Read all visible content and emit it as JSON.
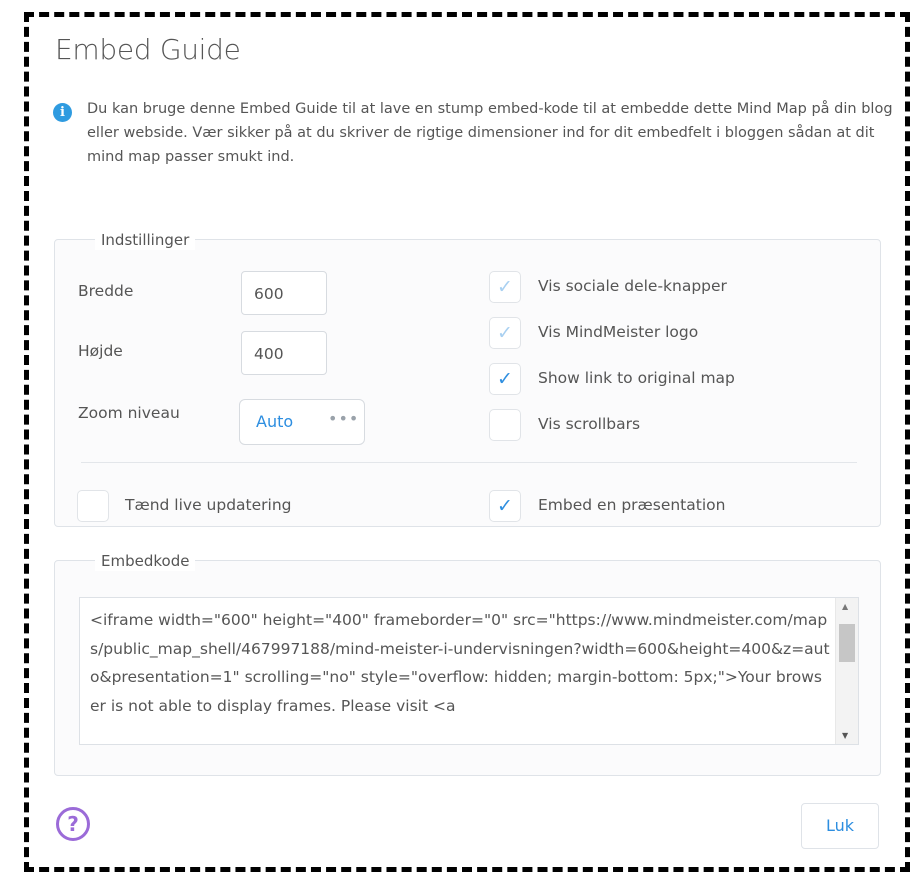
{
  "dialog": {
    "title": "Embed Guide",
    "info_text": "Du kan bruge denne Embed Guide til at lave en stump embed-kode til at embedde dette Mind Map på din blog eller webside. Vær sikker på at du skriver de rigtige dimensioner ind for dit embedfelt i bloggen sådan at dit mind map passer smukt ind.",
    "close_label": "Luk"
  },
  "settings": {
    "legend": "Indstillinger",
    "width_label": "Bredde",
    "width_value": "600",
    "height_label": "Højde",
    "height_value": "400",
    "zoom_label": "Zoom niveau",
    "zoom_value": "Auto",
    "zoom_more": "•••",
    "checkboxes": [
      {
        "label": "Vis sociale dele-knapper",
        "checked": true,
        "enabled": false
      },
      {
        "label": "Vis MindMeister logo",
        "checked": true,
        "enabled": false
      },
      {
        "label": "Show link to original map",
        "checked": true,
        "enabled": true
      },
      {
        "label": "Vis scrollbars",
        "checked": false,
        "enabled": true
      }
    ],
    "live_update_label": "Tænd live updatering",
    "live_update_checked": false,
    "presentation_label": "Embed en præsentation",
    "presentation_checked": true
  },
  "embed": {
    "legend": "Embedkode",
    "code": "<iframe width=\"600\" height=\"400\" frameborder=\"0\" src=\"https://www.mindmeister.com/maps/public_map_shell/467997188/mind-meister-i-undervisningen?width=600&height=400&z=auto&presentation=1\" scrolling=\"no\" style=\"overflow: hidden; margin-bottom: 5px;\">Your browser is not able to display frames. Please visit <a"
  },
  "icons": {
    "check": "✓",
    "info": "i",
    "help": "?",
    "scroll_up": "▲",
    "scroll_down": "▼"
  },
  "colors": {
    "accent": "#2d8ee0",
    "help": "#9b6bd8",
    "info": "#2f9be0"
  }
}
